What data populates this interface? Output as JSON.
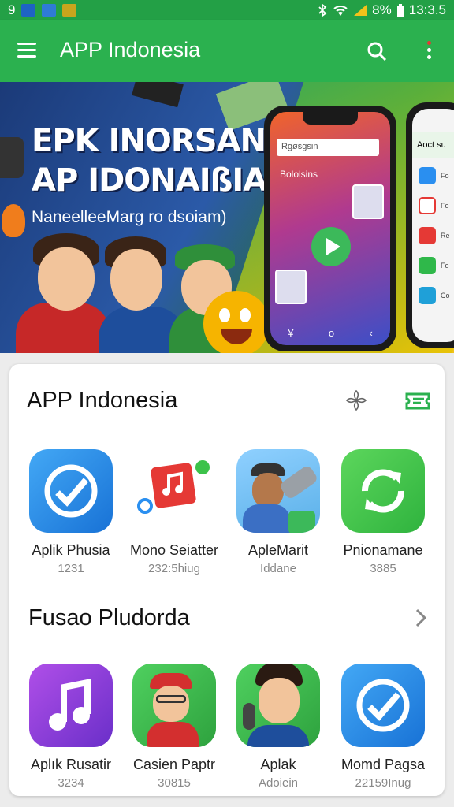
{
  "status_bar": {
    "left_text": "9",
    "battery": "8%",
    "time": "13:3.5"
  },
  "app_bar": {
    "title": "APP Indonesia"
  },
  "banner": {
    "headline_line1": "EPK INORSAN",
    "headline_line2": "AP IDONAIßIAL",
    "subline": "NaneelleeMarg ro dsoiam)",
    "phone_search": "Rgøsgsin",
    "phone_label": "Bololsins",
    "phone_nav": [
      "¥",
      "o",
      "‹"
    ],
    "phone2_header": "Aoct su",
    "phone2_items": [
      "Fo",
      "Fo",
      "Re",
      "Fo",
      "Co"
    ]
  },
  "sections": [
    {
      "title": "APP Indonesia",
      "apps": [
        {
          "name": "Aplik Phusia",
          "meta": "1231",
          "icon": "refresh-check-icon",
          "color": "#2a8ff0"
        },
        {
          "name": "Mono Seiatter",
          "meta": "232:5hiug",
          "icon": "music-note-icon",
          "color": "#e53935"
        },
        {
          "name": "ApleMarit",
          "meta": "Iddane",
          "icon": "cartoon-character-icon",
          "color": "#5ab0e8"
        },
        {
          "name": "Pnionamane",
          "meta": "3885",
          "icon": "sync-arrows-icon",
          "color": "#3cc24a"
        }
      ]
    },
    {
      "title": "Fusao Pludorda",
      "apps": [
        {
          "name": "Aplık Rusatir",
          "meta": "3234",
          "icon": "music-note-icon",
          "color": "#8a3fd8"
        },
        {
          "name": "Casien Paptr",
          "meta": "30815",
          "icon": "cartoon-character-icon",
          "color": "#37b34a"
        },
        {
          "name": "Aplak",
          "meta": "Adoiein",
          "icon": "cartoon-character-icon",
          "color": "#37b34a"
        },
        {
          "name": "Momd Pagsa",
          "meta": "22159Inug",
          "icon": "refresh-check-icon",
          "color": "#2a8ff0"
        }
      ]
    }
  ],
  "colors": {
    "app_bar": "#2bb14f",
    "status_bar": "#23a046",
    "accent": "#2bb14f"
  }
}
